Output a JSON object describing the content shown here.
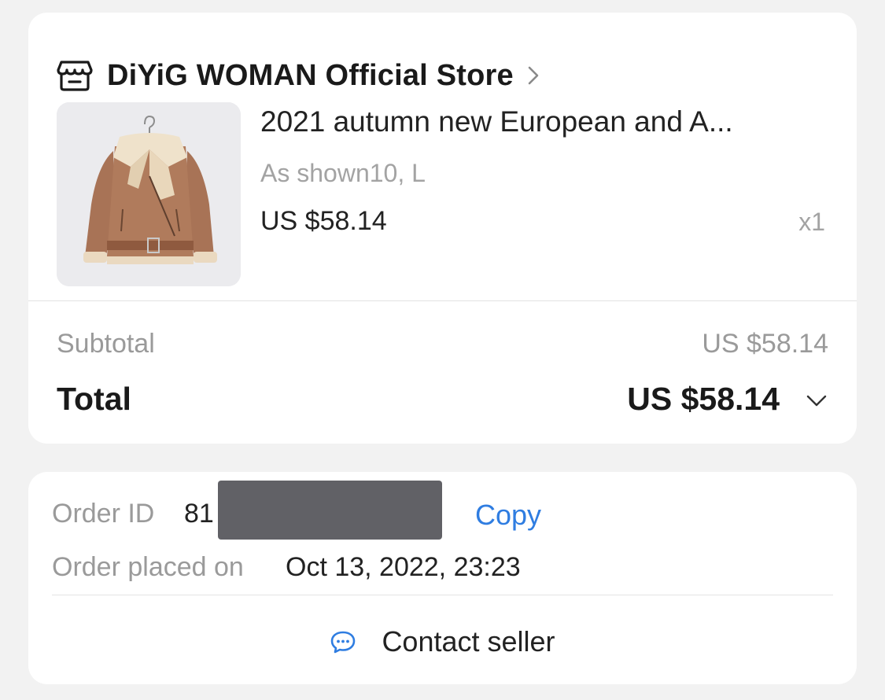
{
  "store": {
    "icon": "store-icon",
    "name": "DiYiG WOMAN Official Store"
  },
  "product": {
    "title": "2021 autumn new European and A...",
    "variant": "As shown10, L",
    "price": "US $58.14",
    "quantity": "x1",
    "image": "brown-shearling-jacket"
  },
  "summary": {
    "subtotal_label": "Subtotal",
    "subtotal_value": "US $58.14",
    "total_label": "Total",
    "total_value": "US $58.14"
  },
  "order": {
    "id_label": "Order ID",
    "id_visible_prefix": "81",
    "copy_label": "Copy",
    "placed_label": "Order placed on",
    "placed_value": "Oct 13, 2022, 23:23"
  },
  "contact": {
    "icon": "chat-bubble-icon",
    "label": "Contact seller"
  },
  "colors": {
    "background": "#f2f2f2",
    "card": "#ffffff",
    "link_blue": "#2f7de1",
    "muted_text": "#9a9a9a",
    "redaction": "#616166"
  }
}
